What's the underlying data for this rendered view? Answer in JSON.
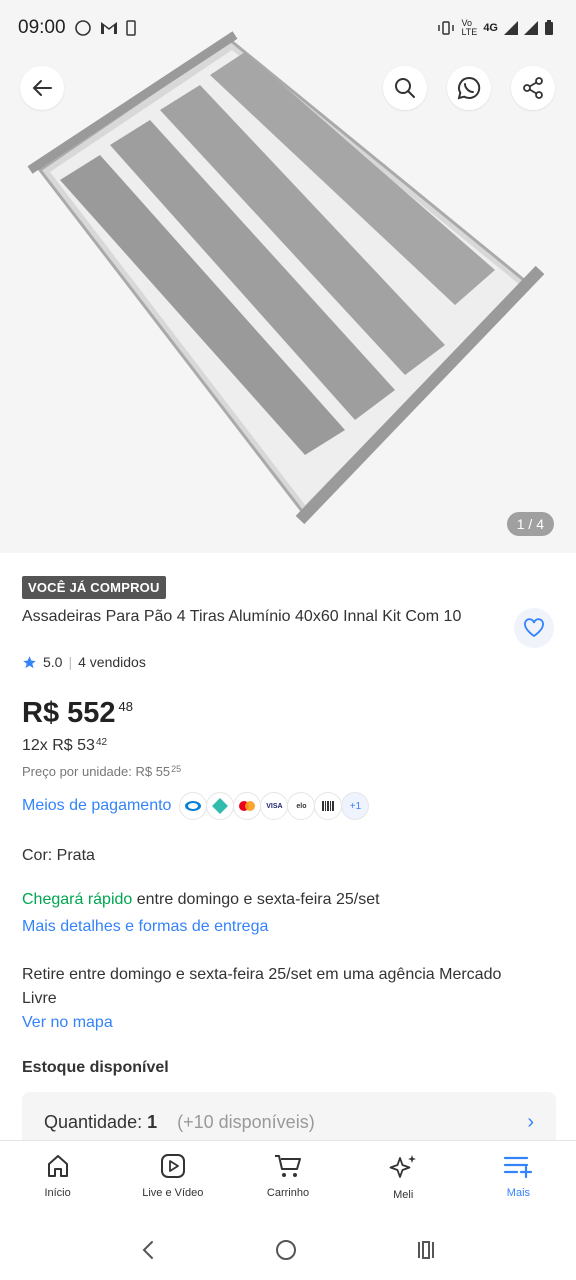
{
  "status_bar": {
    "time": "09:00",
    "network_label": "4G"
  },
  "product": {
    "image_counter": "1 / 4",
    "badge": "VOCÊ JÁ COMPROU",
    "title": "Assadeiras Para Pão 4 Tiras Alumínio 40x60 Innal Kit Com 10",
    "rating": "5.0",
    "sold": "4 vendidos",
    "price_main": "R$ 552",
    "price_cents": "48",
    "installments": "12x R$ 53",
    "installments_cents": "42",
    "unit_price": "Preço por unidade: R$ 55",
    "unit_price_cents": "25",
    "payment_link": "Meios de pagamento",
    "payment_more": "+1",
    "color_label": "Cor: ",
    "color_value": "Prata",
    "delivery_fast": "Chegará rápido",
    "delivery_text": " entre domingo e sexta-feira 25/set",
    "delivery_link": "Mais detalhes e formas de entrega",
    "pickup_text": "Retire entre domingo e sexta-feira 25/set em uma agência Mercado Livre",
    "map_link": "Ver no mapa",
    "stock_title": "Estoque disponível",
    "quantity_label": "Quantidade:",
    "quantity_value": "1",
    "quantity_available": "(+10 disponíveis)"
  },
  "bottom_nav": [
    {
      "label": "Início",
      "icon": "home-icon"
    },
    {
      "label": "Live e Vídeo",
      "icon": "play-icon"
    },
    {
      "label": "Carrinho",
      "icon": "cart-icon"
    },
    {
      "label": "Meli",
      "icon": "sparkle-icon"
    },
    {
      "label": "Mais",
      "icon": "menu-plus-icon"
    }
  ],
  "colors": {
    "accent": "#3483fa",
    "green": "#00a650",
    "badge": "#555555"
  }
}
